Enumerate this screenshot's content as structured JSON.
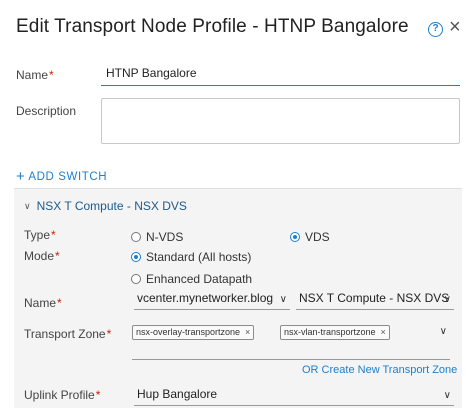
{
  "dialog": {
    "title": "Edit Transport Node Profile - HTNP Bangalore",
    "help_icon": "question-circle-icon",
    "close_icon": "close-icon",
    "help_glyph": "?",
    "close_glyph": "×"
  },
  "form": {
    "name_label": "Name",
    "name_value": "HTNP Bangalore",
    "description_label": "Description",
    "description_value": "",
    "required_marker": "*"
  },
  "add_switch": {
    "label": "ADD SWITCH",
    "icon": "plus-icon",
    "glyph": "+"
  },
  "switch_panel": {
    "header": "NSX T Compute - NSX DVS",
    "expand_icon": "chevron-down-icon",
    "type_label": "Type",
    "type_options": [
      "N-VDS",
      "VDS"
    ],
    "type_selected": "VDS",
    "mode_label": "Mode",
    "mode_options": [
      "Standard (All hosts)",
      "Enhanced Datapath"
    ],
    "mode_selected": "Standard (All hosts)",
    "name_label": "Name",
    "vcenter_value": "vcenter.mynetworker.blog",
    "switch_value": "NSX T Compute - NSX DVS",
    "transport_zone_label": "Transport Zone",
    "transport_zones": [
      "nsx-overlay-transportzone",
      "nsx-vlan-transportzone"
    ],
    "create_link": "OR Create New Transport Zone",
    "uplink_label": "Uplink Profile",
    "uplink_value": "Hup Bangalore"
  },
  "colors": {
    "accent": "#1e7fcb",
    "required": "#c92100",
    "panel_bg": "#f4f4f4"
  }
}
